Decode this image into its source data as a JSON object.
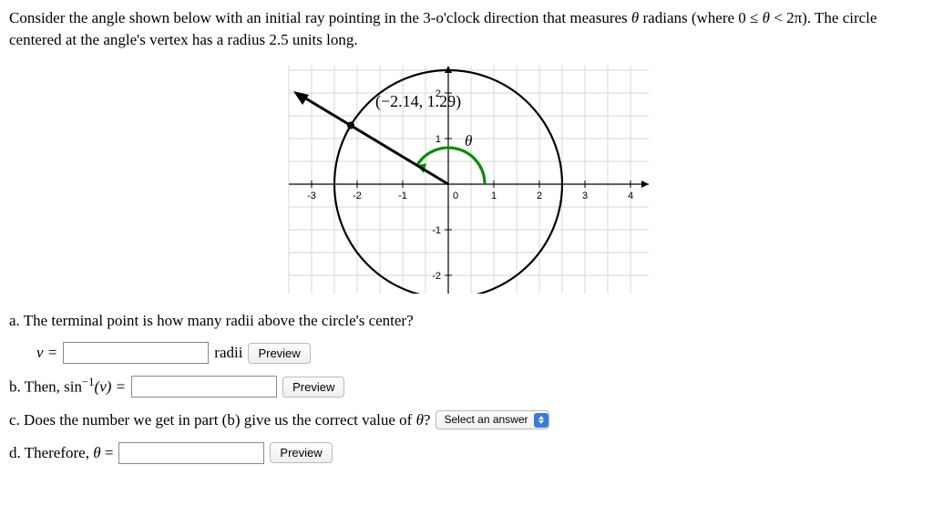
{
  "intro": {
    "line1_a": "Consider the angle shown below with an initial ray pointing in the 3-o'clock direction that measures ",
    "theta": "θ",
    "line1_b": " radians (where 0 ≤ ",
    "line1_c": " < 2π). The circle",
    "line2": "centered at the angle's vertex has a radius 2.5 units long."
  },
  "chart_data": {
    "type": "diagram",
    "circle": {
      "center": [
        0,
        0
      ],
      "radius": 2.5
    },
    "terminal_point": {
      "x": -2.14,
      "y": 1.29,
      "label": "(−2.14, 1.29)"
    },
    "angle_label": "θ",
    "x_axis": {
      "min": -3.5,
      "max": 4.5,
      "ticks": [
        -3,
        -2,
        -1,
        0,
        1,
        2,
        3,
        4
      ]
    },
    "y_axis": {
      "min": -2.8,
      "max": 2.6,
      "ticks": [
        -2,
        -1,
        1,
        2
      ]
    },
    "initial_ray_direction_deg": 0,
    "terminal_ray_direction_deg": 149
  },
  "qa": {
    "a_text": "a. The terminal point is how many radii above the circle's center?",
    "a_var": "v =",
    "a_unit": "radii",
    "b_before": "b. Then, sin",
    "b_exp": "−1",
    "b_arg": "(v) =",
    "c_text": "c. Does the number we get in part (b) give us the correct value of ",
    "c_theta": "θ",
    "c_q": "?",
    "d_text": "d. Therefore, ",
    "d_theta": "θ",
    "d_eq": " ="
  },
  "controls": {
    "preview": "Preview",
    "select_placeholder": "Select an answer"
  }
}
